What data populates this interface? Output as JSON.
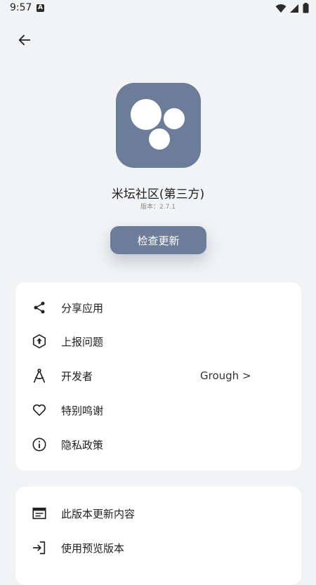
{
  "status_bar": {
    "time": "9:57",
    "notification_icon": "a-notification-icon",
    "icons": [
      "wifi-icon",
      "signal-icon",
      "battery-icon"
    ]
  },
  "header": {
    "back_icon": "arrow-left-icon"
  },
  "app": {
    "name": "米坛社区(第三方)",
    "version": "版本：2.7.1",
    "icon_color": "#6c7d9a"
  },
  "check_update_label": "检查更新",
  "menu_group_1": [
    {
      "icon": "share-icon",
      "label": "分享应用"
    },
    {
      "icon": "report-icon",
      "label": "上报问题"
    },
    {
      "icon": "compass-icon",
      "label": "开发者",
      "value": "Grough >"
    },
    {
      "icon": "heart-icon",
      "label": "特别鸣谢"
    },
    {
      "icon": "info-icon",
      "label": "隐私政策"
    }
  ],
  "menu_group_2": [
    {
      "icon": "calendar-icon",
      "label": "此版本更新内容"
    },
    {
      "icon": "login-icon",
      "label": "使用预览版本"
    }
  ],
  "colors": {
    "accent": "#6c7d9a",
    "background": "#f2f3f5",
    "card": "#ffffff"
  }
}
